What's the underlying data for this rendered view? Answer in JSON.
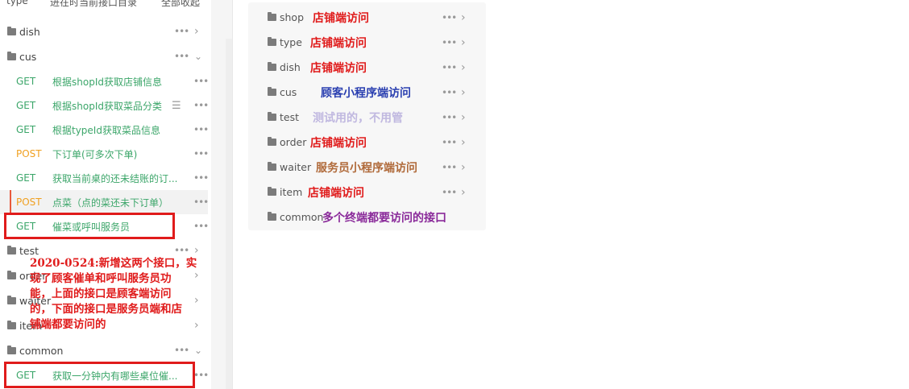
{
  "sidebar": {
    "top_cut": [
      "type",
      "进在时当前接口目录",
      "全部收起"
    ],
    "folders_top": [
      {
        "name": "dish",
        "expanded": false
      },
      {
        "name": "cus",
        "expanded": true
      }
    ],
    "cus_endpoints": [
      {
        "method": "GET",
        "title": "根据shopId获取店铺信息"
      },
      {
        "method": "GET",
        "title": "根据shopId获取菜品分类"
      },
      {
        "method": "GET",
        "title": "根据typeId获取菜品信息"
      },
      {
        "method": "POST",
        "title": "下订单(可多次下单)"
      },
      {
        "method": "GET",
        "title": "获取当前桌的还未结账的订..."
      },
      {
        "method": "POST",
        "title": "点菜（点的菜还未下订单）"
      },
      {
        "method": "GET",
        "title": "催菜或呼叫服务员"
      }
    ],
    "folders_bottom": [
      {
        "name": "test"
      },
      {
        "name": "order"
      },
      {
        "name": "waiter"
      },
      {
        "name": "item"
      },
      {
        "name": "common"
      }
    ],
    "common_endpoints": [
      {
        "method": "GET",
        "title": "获取一分钟内有哪些桌位催..."
      }
    ]
  },
  "annotation": {
    "lines": [
      "2020-0524:新增这两个接口，实",
      "现了顾客催单和呼叫服务员功",
      "能，上面的接口是顾客端访问",
      "的，下面的接口是服务员端和店",
      "铺端都要访问的"
    ]
  },
  "folder_overview": [
    {
      "name": "shop",
      "label": "店铺端访问",
      "color": "#e01b1b"
    },
    {
      "name": "type",
      "label": "店铺端访问",
      "color": "#e01b1b"
    },
    {
      "name": "dish",
      "label": "店铺端访问",
      "color": "#e01b1b"
    },
    {
      "name": "cus",
      "label": "顾客小程序端访问",
      "color": "#2a3fb0"
    },
    {
      "name": "test",
      "label": "测试用的，不用管",
      "color": "#c0b8e0"
    },
    {
      "name": "order",
      "label": "店铺端访问",
      "color": "#e01b1b"
    },
    {
      "name": "waiter",
      "label": "服务员小程序端访问",
      "color": "#b06a3a"
    },
    {
      "name": "item",
      "label": "店铺端访问",
      "color": "#e01b1b"
    },
    {
      "name": "common",
      "label": "多个终端都要访问的接口",
      "color": "#8a2a9a"
    }
  ],
  "icons": {
    "folder": "folder-icon",
    "more": "more-icon",
    "chevron_right": "chevron-right-icon",
    "chevron_down": "chevron-down-icon",
    "menu": "menu-icon"
  },
  "colors": {
    "get": "#3ca66a",
    "post": "#f0a020",
    "highlight": "#e01b1b"
  }
}
